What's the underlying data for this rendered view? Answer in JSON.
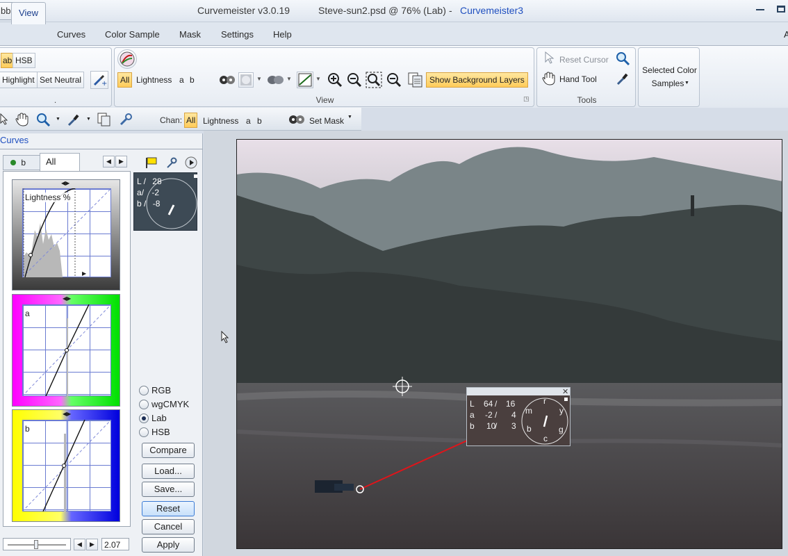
{
  "titlebar": {
    "ribbon_menu": "bbon",
    "app_name": "Curvemeister v3.0.19",
    "document": "Steve-sun2.psd @ 76% (Lab)",
    "separator": "-",
    "brand": "Curvemeister3"
  },
  "menu": {
    "tabs": [
      "View",
      "Curves",
      "Color Sample",
      "Mask",
      "Settings",
      "Help"
    ],
    "right_letter": "A"
  },
  "ribbon": {
    "left_group": {
      "lab_label": "ab",
      "hsb_label": "HSB",
      "highlight": "Highlight",
      "set_neutral": "Set Neutral",
      "dot": "."
    },
    "view_group": {
      "channels": [
        "All",
        "Lightness",
        "a",
        "b"
      ],
      "show_background_layers": "Show Background Layers",
      "label": "View"
    },
    "tools_group": {
      "reset_cursor": "Reset Cursor",
      "hand_tool": "Hand Tool",
      "label": "Tools"
    },
    "selected_group": {
      "line1": "Selected Color",
      "line2": "Samples"
    }
  },
  "toolbar2": {
    "chan_label": "Chan:",
    "channels": [
      "All",
      "Lightness",
      "a",
      "b"
    ],
    "set_mask": "Set Mask"
  },
  "left_panel": {
    "title": "Curves",
    "tab_b": "b",
    "tab_all": "All",
    "lightness_label": "Lightness %",
    "a_label": "a",
    "b_label": "b",
    "readout": {
      "L": "28",
      "a": "-2",
      "b": "-8"
    },
    "modes": [
      "RGB",
      "wgCMYK",
      "Lab",
      "HSB"
    ],
    "selected_mode": "Lab",
    "buttons": {
      "compare": "Compare",
      "load": "Load...",
      "save": "Save...",
      "reset": "Reset",
      "cancel": "Cancel",
      "apply": "Apply"
    },
    "slider_value": "2.07"
  },
  "sample_readout": {
    "rows": [
      {
        "ch": "L",
        "v1": "64",
        "v2": "16"
      },
      {
        "ch": "a",
        "v1": "-2",
        "v2": "4"
      },
      {
        "ch": "b",
        "v1": "10",
        "v2": "3"
      }
    ],
    "dial_labels": {
      "top": "r",
      "right": "y",
      "lower_right": "g",
      "bottom": "c",
      "lower_left": "b",
      "left": "m"
    },
    "slash": "/"
  },
  "colors": {
    "accent_blue": "#1f4fbf",
    "active_orange": "#ffcc5a",
    "sample_line": "#e0141a"
  }
}
